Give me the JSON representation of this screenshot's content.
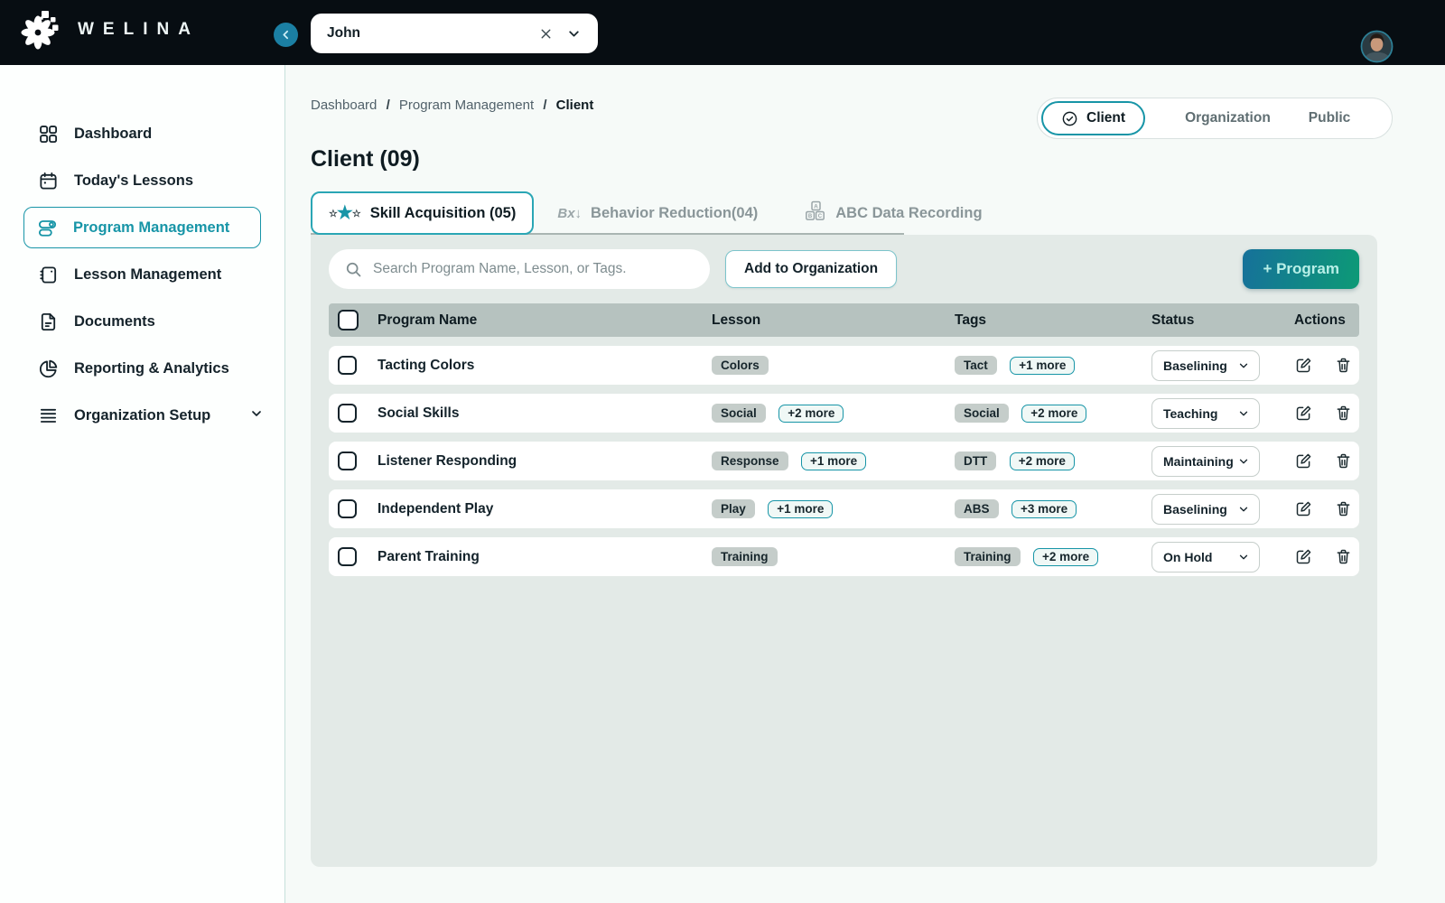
{
  "colors": {
    "accent": "#1795a7",
    "header_bg": "#070d12",
    "panel_bg": "#e3eae7",
    "table_header_bg": "#b6c2bf",
    "chip_bg": "#c5cdca",
    "program_button_gradient_start": "#16719a",
    "program_button_gradient_end": "#0d9a76"
  },
  "brand": {
    "name": "WELINA",
    "logo_icon": "flower-logo-icon"
  },
  "header": {
    "client_selector_value": "John",
    "collapse_icon": "chevron-left-icon",
    "clear_icon": "x-icon",
    "dropdown_icon": "chevron-down-icon",
    "avatar": "user-avatar"
  },
  "sidebar": {
    "items": [
      {
        "label": "Dashboard",
        "icon": "grid-icon",
        "active": false
      },
      {
        "label": "Today's Lessons",
        "icon": "calendar-icon",
        "active": false
      },
      {
        "label": "Program Management",
        "icon": "program-list-icon",
        "active": true
      },
      {
        "label": "Lesson Management",
        "icon": "notebook-icon",
        "active": false
      },
      {
        "label": "Documents",
        "icon": "document-icon",
        "active": false
      },
      {
        "label": "Reporting & Analytics",
        "icon": "pie-chart-icon",
        "active": false
      },
      {
        "label": "Organization Setup",
        "icon": "stack-icon",
        "active": false,
        "has_chevron": true
      }
    ]
  },
  "breadcrumb": {
    "crumbs": [
      "Dashboard",
      "Program Management"
    ],
    "current": "Client",
    "separator": "/"
  },
  "view_toggle": {
    "selected": "Client",
    "selected_icon": "check-circle-icon",
    "options": [
      "Organization",
      "Public"
    ]
  },
  "page": {
    "title": "Client (09)"
  },
  "tabs": [
    {
      "label": "Skill Acquisition (05)",
      "icon": "stars-icon",
      "active": true,
      "star_small": "☆",
      "star_big": "★"
    },
    {
      "label": "Behavior Reduction(04)",
      "icon": "bx-arrow-icon",
      "active": false,
      "icon_text": "Bx↓"
    },
    {
      "label": "ABC Data Recording",
      "icon": "abc-blocks-icon",
      "active": false,
      "block_letters": [
        "A",
        "B",
        "C"
      ]
    }
  ],
  "controls": {
    "search_placeholder": "Search Program Name, Lesson, or Tags.",
    "add_to_organization": "Add to Organization",
    "program_button": "+ Program"
  },
  "table": {
    "columns": [
      "Program Name",
      "Lesson",
      "Tags",
      "Status",
      "Actions"
    ],
    "rows": [
      {
        "name": "Tacting Colors",
        "lesson": "Colors",
        "lesson_more": "",
        "tag": "Tact",
        "tag_more": "+1 more",
        "status": "Baselining"
      },
      {
        "name": "Social Skills",
        "lesson": "Social",
        "lesson_more": "+2 more",
        "tag": "Social",
        "tag_more": "+2 more",
        "status": "Teaching"
      },
      {
        "name": "Listener Responding",
        "lesson": "Response",
        "lesson_more": "+1 more",
        "tag": "DTT",
        "tag_more": "+2 more",
        "status": "Maintaining"
      },
      {
        "name": "Independent Play",
        "lesson": "Play",
        "lesson_more": "+1 more",
        "tag": "ABS",
        "tag_more": "+3 more",
        "status": "Baselining"
      },
      {
        "name": "Parent Training",
        "lesson": "Training",
        "lesson_more": "",
        "tag": "Training",
        "tag_more": "+2 more",
        "status": "On Hold"
      }
    ]
  }
}
